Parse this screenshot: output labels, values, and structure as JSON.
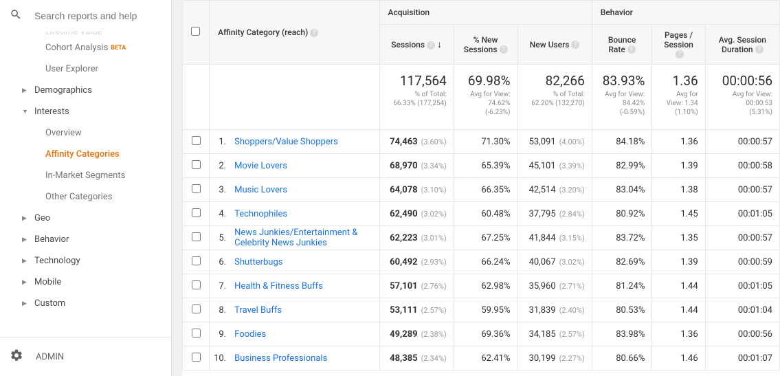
{
  "search": {
    "placeholder": "Search reports and help"
  },
  "sidebar": {
    "items": [
      {
        "label": "Lifetime Value",
        "type": "child"
      },
      {
        "label": "Cohort Analysis",
        "type": "child",
        "beta": "BETA"
      },
      {
        "label": "User Explorer",
        "type": "child"
      },
      {
        "label": "Demographics",
        "type": "header",
        "expand": false
      },
      {
        "label": "Interests",
        "type": "header",
        "expand": true
      },
      {
        "label": "Overview",
        "type": "child"
      },
      {
        "label": "Affinity Categories",
        "type": "child",
        "active": true
      },
      {
        "label": "In-Market Segments",
        "type": "child"
      },
      {
        "label": "Other Categories",
        "type": "child"
      },
      {
        "label": "Geo",
        "type": "header",
        "expand": false
      },
      {
        "label": "Behavior",
        "type": "header",
        "expand": false
      },
      {
        "label": "Technology",
        "type": "header",
        "expand": false
      },
      {
        "label": "Mobile",
        "type": "header",
        "expand": false
      },
      {
        "label": "Custom",
        "type": "header",
        "expand": false
      }
    ],
    "admin": "ADMIN"
  },
  "table": {
    "dimension_label": "Affinity Category (reach)",
    "groups": {
      "acq": "Acquisition",
      "beh": "Behavior"
    },
    "columns": {
      "sessions": "Sessions",
      "new_sessions": "% New Sessions",
      "new_users": "New Users",
      "bounce": "Bounce Rate",
      "pages": "Pages / Session",
      "duration": "Avg. Session Duration"
    },
    "summary": {
      "sessions": {
        "val": "117,564",
        "sub1": "% of Total:",
        "sub2": "66.33% (177,254)"
      },
      "new_sessions": {
        "val": "69.98%",
        "sub1": "Avg for View:",
        "sub2": "74.62%",
        "sub3": "(-6.23%)"
      },
      "new_users": {
        "val": "82,266",
        "sub1": "% of Total:",
        "sub2": "62.20% (132,270)"
      },
      "bounce": {
        "val": "83.93%",
        "sub1": "Avg for View:",
        "sub2": "84.42%",
        "sub3": "(-0.59%)"
      },
      "pages": {
        "val": "1.36",
        "sub1": "Avg for",
        "sub2": "View: 1.34",
        "sub3": "(1.10%)"
      },
      "duration": {
        "val": "00:00:56",
        "sub1": "Avg for View:",
        "sub2": "00:00:53",
        "sub3": "(5.31%)"
      }
    },
    "rows": [
      {
        "rank": "1.",
        "cat": "Shoppers/Value Shoppers",
        "sessions": "74,463",
        "sessions_pct": "(3.60%)",
        "new_sessions": "71.30%",
        "new_users": "53,091",
        "new_users_pct": "(4.00%)",
        "bounce": "84.18%",
        "pages": "1.36",
        "duration": "00:00:57"
      },
      {
        "rank": "2.",
        "cat": "Movie Lovers",
        "sessions": "68,970",
        "sessions_pct": "(3.34%)",
        "new_sessions": "65.39%",
        "new_users": "45,101",
        "new_users_pct": "(3.39%)",
        "bounce": "82.99%",
        "pages": "1.39",
        "duration": "00:00:58"
      },
      {
        "rank": "3.",
        "cat": "Music Lovers",
        "sessions": "64,078",
        "sessions_pct": "(3.10%)",
        "new_sessions": "66.35%",
        "new_users": "42,514",
        "new_users_pct": "(3.20%)",
        "bounce": "83.04%",
        "pages": "1.38",
        "duration": "00:00:57"
      },
      {
        "rank": "4.",
        "cat": "Technophiles",
        "sessions": "62,490",
        "sessions_pct": "(3.02%)",
        "new_sessions": "60.48%",
        "new_users": "37,795",
        "new_users_pct": "(2.84%)",
        "bounce": "80.92%",
        "pages": "1.45",
        "duration": "00:01:05"
      },
      {
        "rank": "5.",
        "cat": "News Junkies/Entertainment & Celebrity News Junkies",
        "sessions": "62,223",
        "sessions_pct": "(3.01%)",
        "new_sessions": "67.25%",
        "new_users": "41,844",
        "new_users_pct": "(3.15%)",
        "bounce": "83.72%",
        "pages": "1.35",
        "duration": "00:00:57"
      },
      {
        "rank": "6.",
        "cat": "Shutterbugs",
        "sessions": "60,492",
        "sessions_pct": "(2.93%)",
        "new_sessions": "66.24%",
        "new_users": "40,067",
        "new_users_pct": "(3.02%)",
        "bounce": "82.69%",
        "pages": "1.39",
        "duration": "00:00:59"
      },
      {
        "rank": "7.",
        "cat": "Health & Fitness Buffs",
        "sessions": "57,101",
        "sessions_pct": "(2.76%)",
        "new_sessions": "62.98%",
        "new_users": "35,960",
        "new_users_pct": "(2.71%)",
        "bounce": "81.24%",
        "pages": "1.44",
        "duration": "00:01:05"
      },
      {
        "rank": "8.",
        "cat": "Travel Buffs",
        "sessions": "53,111",
        "sessions_pct": "(2.57%)",
        "new_sessions": "59.95%",
        "new_users": "31,839",
        "new_users_pct": "(2.40%)",
        "bounce": "80.53%",
        "pages": "1.44",
        "duration": "00:01:04"
      },
      {
        "rank": "9.",
        "cat": "Foodies",
        "sessions": "49,289",
        "sessions_pct": "(2.38%)",
        "new_sessions": "69.36%",
        "new_users": "34,185",
        "new_users_pct": "(2.57%)",
        "bounce": "83.98%",
        "pages": "1.36",
        "duration": "00:00:56"
      },
      {
        "rank": "10.",
        "cat": "Business Professionals",
        "sessions": "48,385",
        "sessions_pct": "(2.34%)",
        "new_sessions": "62.41%",
        "new_users": "30,199",
        "new_users_pct": "(2.27%)",
        "bounce": "80.66%",
        "pages": "1.46",
        "duration": "00:01:07"
      }
    ]
  }
}
